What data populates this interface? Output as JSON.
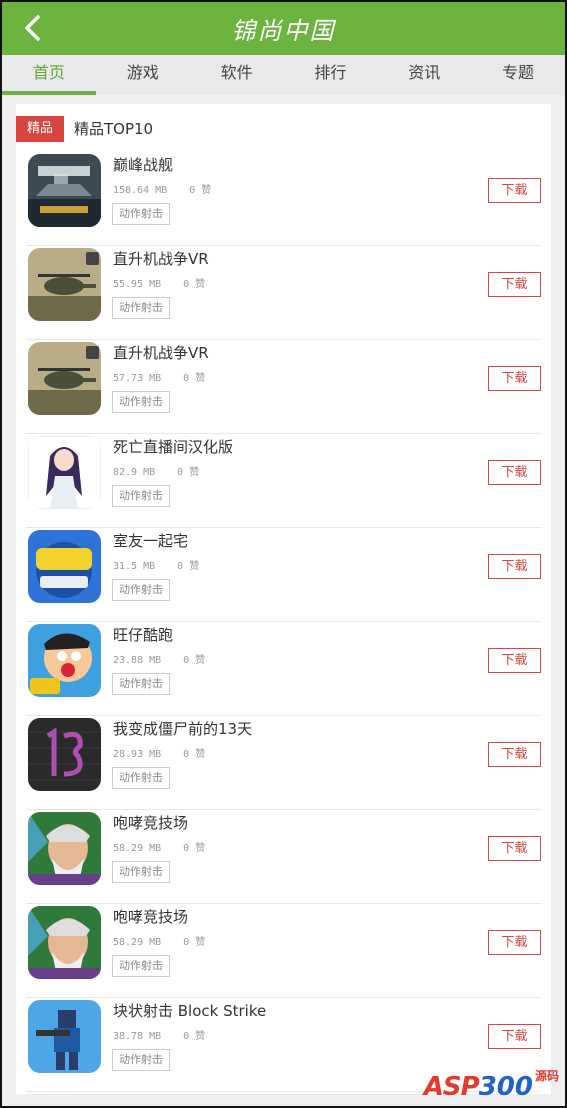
{
  "header": {
    "title": "锦尚中国"
  },
  "tabs": [
    {
      "label": "首页",
      "active": true
    },
    {
      "label": "游戏",
      "active": false
    },
    {
      "label": "软件",
      "active": false
    },
    {
      "label": "排行",
      "active": false
    },
    {
      "label": "资讯",
      "active": false
    },
    {
      "label": "专题",
      "active": false
    }
  ],
  "section": {
    "badge": "精品",
    "title": "精品TOP10"
  },
  "apps": [
    {
      "name": "巅峰战舰",
      "size": "158.64 MB",
      "likes": "0 赞",
      "tag": "动作射击",
      "download": "下载",
      "icon": "warship-icon"
    },
    {
      "name": "直升机战争VR",
      "size": "55.95 MB",
      "likes": "0 赞",
      "tag": "动作射击",
      "download": "下载",
      "icon": "helicopter-icon"
    },
    {
      "name": "直升机战争VR",
      "size": "57.73 MB",
      "likes": "0 赞",
      "tag": "动作射击",
      "download": "下载",
      "icon": "helicopter-icon"
    },
    {
      "name": "死亡直播间汉化版",
      "size": "82.9 MB",
      "likes": "0 赞",
      "tag": "动作射击",
      "download": "下载",
      "icon": "anime-girl-icon"
    },
    {
      "name": "室友一起宅",
      "size": "31.5 MB",
      "likes": "0 赞",
      "tag": "动作射击",
      "download": "下载",
      "icon": "big-brother-icon"
    },
    {
      "name": "旺仔酷跑",
      "size": "23.88 MB",
      "likes": "0 赞",
      "tag": "动作射击",
      "download": "下载",
      "icon": "cartoon-boy-icon"
    },
    {
      "name": "我变成僵尸前的13天",
      "size": "28.93 MB",
      "likes": "0 赞",
      "tag": "动作射击",
      "download": "下载",
      "icon": "number-13-icon"
    },
    {
      "name": "咆哮竞技场",
      "size": "58.29 MB",
      "likes": "0 赞",
      "tag": "动作射击",
      "download": "下载",
      "icon": "old-warrior-icon"
    },
    {
      "name": "咆哮竞技场",
      "size": "58.29 MB",
      "likes": "0 赞",
      "tag": "动作射击",
      "download": "下载",
      "icon": "old-warrior-icon"
    },
    {
      "name": "块状射击 Block Strike",
      "size": "38.78 MB",
      "likes": "0 赞",
      "tag": "动作射击",
      "download": "下载",
      "icon": "blocky-soldier-icon"
    }
  ],
  "watermark": {
    "part1": "ASP",
    "part2": "300",
    "part3": "源码"
  },
  "colors": {
    "brand": "#6db33f",
    "accent": "#d9463f"
  }
}
